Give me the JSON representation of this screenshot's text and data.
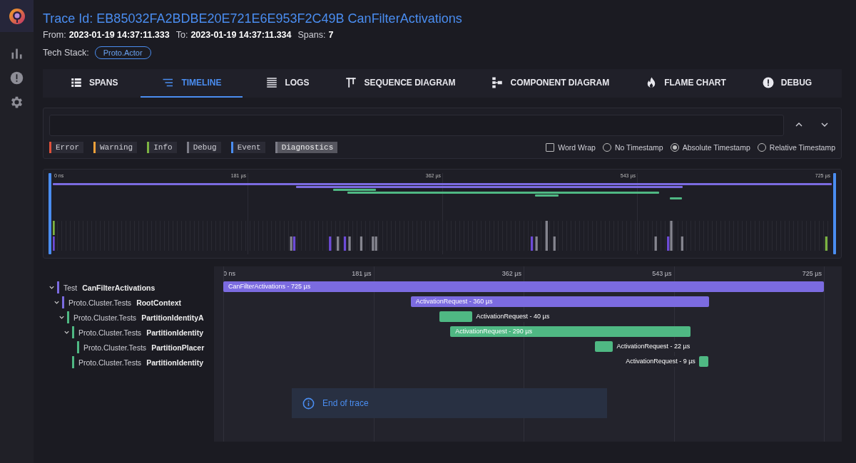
{
  "sidebar": {
    "items": [
      {
        "kind": "chart",
        "selected": false
      },
      {
        "kind": "alert",
        "selected": false
      },
      {
        "kind": "settings",
        "selected": false
      }
    ]
  },
  "header": {
    "title": "Trace Id: EB85032FA2BDBE20E721E6E953F2C49B CanFilterActivations",
    "from_label": "From:",
    "from": "2023-01-19 14:37:11.333",
    "to_label": "To:",
    "to": "2023-01-19 14:37:11.334",
    "spans_label": "Spans:",
    "spans": "7",
    "tech_label": "Tech Stack:",
    "tech": [
      "Proto.Actor"
    ]
  },
  "tabs": [
    {
      "label": "SPANS",
      "kind": "spans",
      "selected": false
    },
    {
      "label": "TIMELINE",
      "kind": "timeline",
      "selected": true
    },
    {
      "label": "LOGS",
      "kind": "logs",
      "selected": false
    },
    {
      "label": "SEQUENCE DIAGRAM",
      "kind": "sequence",
      "selected": false
    },
    {
      "label": "COMPONENT DIAGRAM",
      "kind": "component",
      "selected": false
    },
    {
      "label": "FLAME CHART",
      "kind": "flame",
      "selected": false
    },
    {
      "label": "DEBUG",
      "kind": "debug",
      "selected": false
    }
  ],
  "logs": {
    "levels": [
      {
        "label": "Error",
        "color": "#e0513a",
        "selected": false
      },
      {
        "label": "Warning",
        "color": "#f0a13a",
        "selected": false
      },
      {
        "label": "Info",
        "color": "#7cb342",
        "selected": false
      },
      {
        "label": "Debug",
        "color": "#7d7d88",
        "selected": false
      },
      {
        "label": "Event",
        "color": "#4a8df0",
        "selected": false
      },
      {
        "label": "Diagnostics",
        "color": "#7d7d88",
        "selected": true
      }
    ],
    "word_wrap": {
      "label": "Word Wrap",
      "checked": false
    },
    "timestamps": [
      {
        "label": "No Timestamp",
        "selected": false
      },
      {
        "label": "Absolute Timestamp",
        "selected": true
      },
      {
        "label": "Relative Timestamp",
        "selected": false
      }
    ]
  },
  "minimap": {
    "ticks": [
      "0 ns",
      "181 µs",
      "362 µs",
      "543 µs",
      "725 µs"
    ]
  },
  "timeline": {
    "ticks": [
      "0 ns",
      "181 µs",
      "362 µs",
      "543 µs",
      "725 µs"
    ],
    "spans": [
      {
        "service": "Test",
        "name": "CanFilterActivations",
        "color": "#7b6be0",
        "bar_label": "CanFilterActivations - 725 µs",
        "expanded": true,
        "children": [
          {
            "service": "Proto.Cluster.Tests",
            "name": "RootContext",
            "color": "#7b6be0",
            "bar_label": "ActivationRequest - 360 µs",
            "expanded": true,
            "children": [
              {
                "service": "Proto.Cluster.Tests",
                "name": "PartitionIdentityA",
                "color": "#4fb883",
                "bar_label": "ActivationRequest - 40 µs",
                "expanded": true,
                "children": [
                  {
                    "service": "Proto.Cluster.Tests",
                    "name": "PartitionIdentity",
                    "color": "#4fb883",
                    "bar_label": "ActivationRequest - 290 µs",
                    "expanded": true,
                    "children": [
                      {
                        "service": "Proto.Cluster.Tests",
                        "name": "PartitionPlacer",
                        "color": "#4fb883",
                        "bar_label": "ActivationRequest - 22 µs"
                      }
                    ]
                  },
                  {
                    "service": "Proto.Cluster.Tests",
                    "name": "PartitionIdentity",
                    "color": "#4fb883",
                    "bar_label": "ActivationRequest - 9 µs"
                  }
                ]
              }
            ]
          }
        ]
      }
    ],
    "end_message": "End of trace"
  }
}
